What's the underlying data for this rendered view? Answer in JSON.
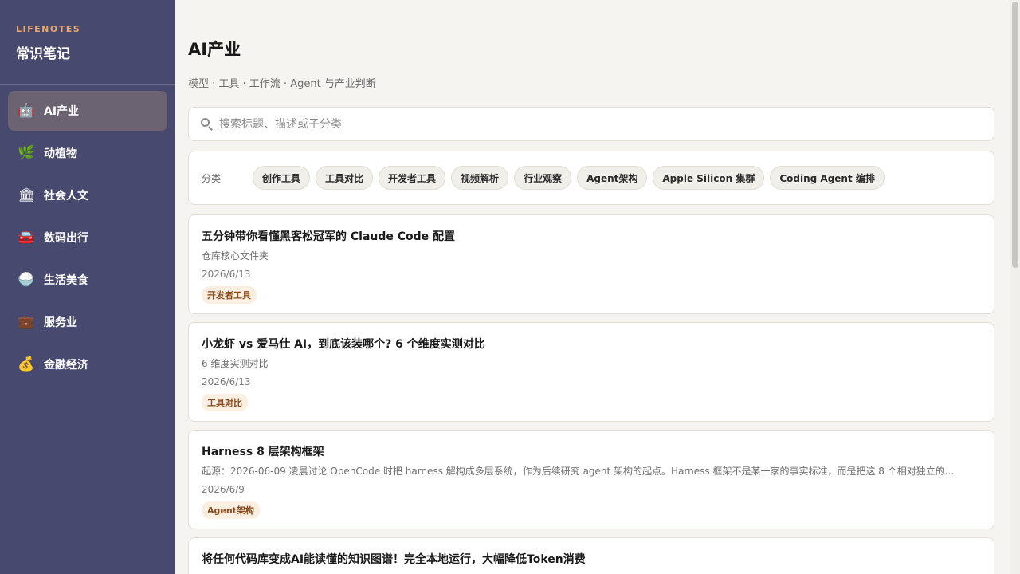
{
  "sidebar": {
    "brand_en": "LIFENOTES",
    "brand_cn": "常识笔记",
    "items": [
      {
        "label": "AI产业",
        "icon": "🤖",
        "icon_name": "robot-icon",
        "active": true
      },
      {
        "label": "动植物",
        "icon": "🌿",
        "icon_name": "herb-icon",
        "active": false
      },
      {
        "label": "社会人文",
        "icon": "🏛",
        "icon_name": "classical-building-icon",
        "active": false
      },
      {
        "label": "数码出行",
        "icon": "🚘",
        "icon_name": "car-icon",
        "active": false
      },
      {
        "label": "生活美食",
        "icon": "🍚",
        "icon_name": "rice-bowl-icon",
        "active": false
      },
      {
        "label": "服务业",
        "icon": "💼",
        "icon_name": "briefcase-icon",
        "active": false
      },
      {
        "label": "金融经济",
        "icon": "💰",
        "icon_name": "money-bag-icon",
        "active": false
      }
    ]
  },
  "main": {
    "title": "AI产业",
    "subtitle": "模型 · 工具 · 工作流 · Agent 与产业判断",
    "search": {
      "placeholder": "搜索标题、描述或子分类",
      "value": ""
    },
    "category_label": "分类",
    "categories": [
      "创作工具",
      "工具对比",
      "开发者工具",
      "视频解析",
      "行业观察",
      "Agent架构",
      "Apple Silicon 集群",
      "Coding Agent 编排"
    ],
    "cards": [
      {
        "title": "五分钟带你看懂黑客松冠军的 Claude Code 配置",
        "desc": "仓库核心文件夹",
        "date": "2026/6/13",
        "tag": "开发者工具"
      },
      {
        "title": "小龙虾 vs 爱马仕 AI，到底该装哪个? 6 个维度实测对比",
        "desc": "6 维度实测对比",
        "date": "2026/6/13",
        "tag": "工具对比"
      },
      {
        "title": "Harness 8 层架构框架",
        "desc": "起源：2026-06-09 凌晨讨论 OpenCode 时把 harness 解构成多层系统，作为后续研究 agent 架构的起点。Harness 框架不是某一家的事实标准，而是把这 8 个相对独立的...",
        "date": "2026/6/9",
        "tag": "Agent架构"
      },
      {
        "title": "将任何代码库变成AI能读懂的知识图谱！完全本地运行，大幅降低Token消费",
        "desc": "",
        "date": "",
        "tag": ""
      }
    ]
  },
  "colors": {
    "sidebar_bg": "#474a6e",
    "sidebar_active": "#6b6272",
    "brand_accent": "#f0a868",
    "tag_bg": "#fbefe2",
    "tag_text": "#8a4a1c"
  }
}
